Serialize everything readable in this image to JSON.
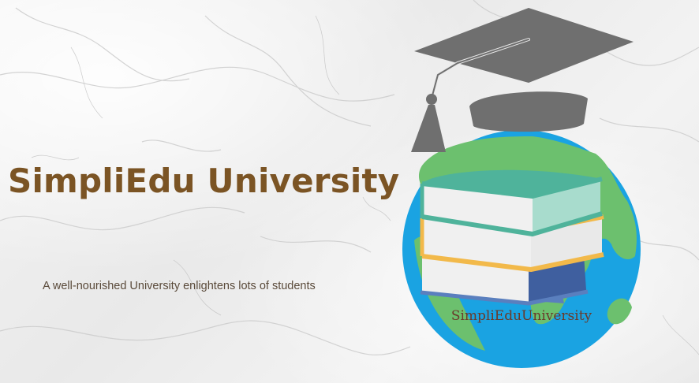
{
  "banner": {
    "title": "SimpliEdu University",
    "tagline": "A well-nourished University enlightens lots of students"
  },
  "logo": {
    "caption": "SimpliEduUniversity",
    "icons": [
      "graduation-cap-icon",
      "globe-icon",
      "book-stack-icon"
    ]
  },
  "colors": {
    "title": "#7b5424",
    "ocean": "#1aa3e2",
    "land": "#6cc06e",
    "cap": "#6f6f6f",
    "book_top": "#4fb39b",
    "book_middle": "#f2b94a",
    "book_bottom": "#5a7fbe"
  }
}
